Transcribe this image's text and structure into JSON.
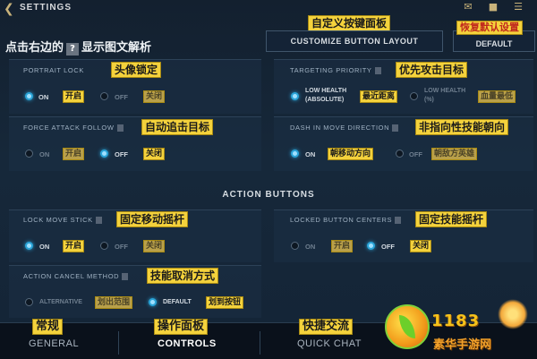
{
  "header": {
    "back_icon": "chevron-left-icon",
    "title": "SETTINGS",
    "icons": [
      "mail-icon",
      "chat-icon",
      "menu-icon"
    ]
  },
  "hint": {
    "prefix": "点击右边的",
    "q": "?",
    "suffix": "显示图文解析"
  },
  "customize": {
    "cn_label": "自定义按键面板",
    "button_label": "CUSTOMIZE BUTTON LAYOUT"
  },
  "default_btn": {
    "cn_label": "恢复默认设置",
    "button_label": "DEFAULT"
  },
  "portrait_lock": {
    "label": "PORTRAIT LOCK",
    "cn_label": "头像锁定",
    "opt_on": "ON",
    "opt_on_cn": "开启",
    "opt_off": "OFF",
    "opt_off_cn": "关闭",
    "selected": "on"
  },
  "targeting_priority": {
    "label": "TARGETING PRIORITY",
    "cn_label": "优先攻击目标",
    "opt1_a": "LOW HEALTH",
    "opt1_b": "(ABSOLUTE)",
    "opt1_cn": "最近距离",
    "opt2_a": "LOW HEALTH",
    "opt2_b": "(%)",
    "opt2_cn": "血量最低",
    "selected": "opt1"
  },
  "force_attack_follow": {
    "label": "FORCE ATTACK FOLLOW",
    "cn_label": "自动追击目标",
    "opt_on": "ON",
    "opt_on_cn": "开启",
    "opt_off": "OFF",
    "opt_off_cn": "关闭",
    "selected": "off"
  },
  "dash_direction": {
    "label": "DASH IN MOVE DIRECTION",
    "cn_label": "非指向性技能朝向",
    "opt_on": "ON",
    "opt_on_cn": "朝移动方向",
    "opt_off": "OFF",
    "opt_off_cn": "朝敌方英雄",
    "selected": "on"
  },
  "action_buttons_title": "ACTION BUTTONS",
  "lock_move_stick": {
    "label": "LOCK MOVE STICK",
    "cn_label": "固定移动摇杆",
    "opt_on": "ON",
    "opt_on_cn": "开启",
    "opt_off": "OFF",
    "opt_off_cn": "关闭",
    "selected": "on"
  },
  "locked_button_centers": {
    "label": "LOCKED BUTTON CENTERS",
    "cn_label": "固定技能摇杆",
    "opt_on": "ON",
    "opt_on_cn": "开启",
    "opt_off": "OFF",
    "opt_off_cn": "关闭",
    "selected": "off"
  },
  "action_cancel": {
    "label": "ACTION CANCEL METHOD",
    "cn_label": "技能取消方式",
    "opt1": "ALTERNATIVE",
    "opt1_cn": "划出范围",
    "opt2": "DEFAULT",
    "opt2_cn": "划到按钮",
    "selected": "opt2"
  },
  "nav": {
    "general": "GENERAL",
    "general_cn": "常规",
    "controls": "CONTROLS",
    "controls_cn": "操作面板",
    "quick_chat": "QUICK CHAT",
    "quick_chat_cn": "快捷交流"
  },
  "watermark": {
    "number": "1183",
    "site": "素华手游网"
  },
  "colors": {
    "accent": "#2aa4d8",
    "label_bg": "#f4d23c",
    "background": "#13202f"
  }
}
